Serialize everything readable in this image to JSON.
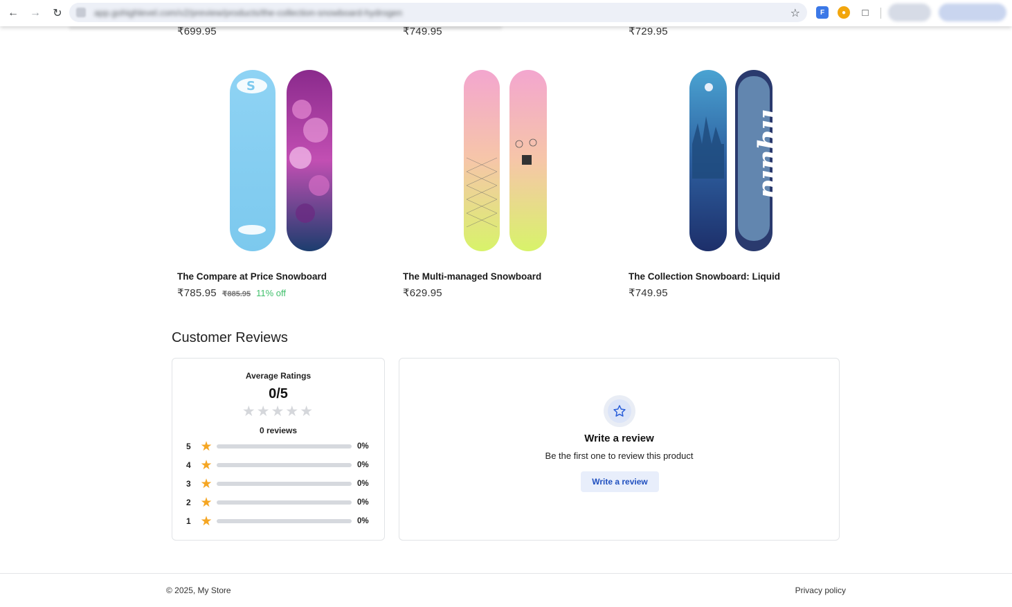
{
  "browser": {
    "url": "app.gohighlevel.com/v2/preview/products/the-collection-snowboard-hydrogen"
  },
  "top_row_prices": [
    "₹699.95",
    "₹749.95",
    "₹729.95"
  ],
  "products": [
    {
      "title": "The Compare at Price Snowboard",
      "price": "₹785.95",
      "compare_price": "₹885.95",
      "discount": "11% off"
    },
    {
      "title": "The Multi-managed Snowboard",
      "price": "₹629.95",
      "compare_price": "",
      "discount": ""
    },
    {
      "title": "The Collection Snowboard: Liquid",
      "price": "₹749.95",
      "compare_price": "",
      "discount": ""
    }
  ],
  "reviews": {
    "section_title": "Customer Reviews",
    "average_label": "Average Ratings",
    "average_value": "0/5",
    "count_label": "0 reviews",
    "distribution": [
      {
        "stars": "5",
        "percent": "0%",
        "fill": 0
      },
      {
        "stars": "4",
        "percent": "0%",
        "fill": 0
      },
      {
        "stars": "3",
        "percent": "0%",
        "fill": 0
      },
      {
        "stars": "2",
        "percent": "0%",
        "fill": 0
      },
      {
        "stars": "1",
        "percent": "0%",
        "fill": 0
      }
    ],
    "write_heading": "Write a review",
    "write_sub": "Be the first one to review this product",
    "write_button": "Write a review"
  },
  "footer": {
    "copyright": "© 2025, My Store",
    "privacy": "Privacy policy"
  },
  "colors": {
    "star_filled": "#f5a623",
    "star_empty": "#d5d7db",
    "discount": "#3fbf6a",
    "accent": "#1f4fbf"
  }
}
